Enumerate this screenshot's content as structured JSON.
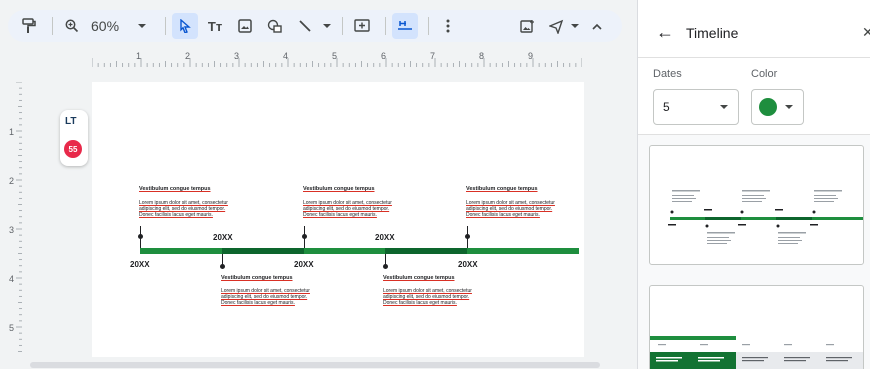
{
  "toolbar": {
    "zoom": "60%"
  },
  "ruler": {
    "h_numbers": [
      "1",
      "2",
      "3",
      "4",
      "5",
      "6",
      "7",
      "8",
      "9"
    ],
    "v_numbers": [
      "1",
      "2",
      "3",
      "4",
      "5"
    ]
  },
  "languagetool": {
    "badge_count": "55",
    "logo_text": "LT"
  },
  "timeline": {
    "accent_color": "#1e8e3e",
    "dark_segment_color": "#0d652d",
    "dates": [
      "20XX",
      "20XX",
      "20XX",
      "20XX",
      "20XX"
    ],
    "events": [
      {
        "title": "Vestibulum congue tempus",
        "body": "Lorem ipsum dolor sit amet, consectetur adipiscing elit, sed do eiusmod tempor. Donec facilisis lacus eget mauris."
      },
      {
        "title": "Vestibulum congue tempus",
        "body": "Lorem ipsum dolor sit amet, consectetur adipiscing elit, sed do eiusmod tempor. Donec facilisis lacus eget mauris."
      },
      {
        "title": "Vestibulum congue tempus",
        "body": "Lorem ipsum dolor sit amet, consectetur adipiscing elit, sed do eiusmod tempor. Donec facilisis lacus eget mauris."
      },
      {
        "title": "Vestibulum congue tempus",
        "body": "Lorem ipsum dolor sit amet, consectetur adipiscing elit, sed do eiusmod tempor. Donec facilisis lacus eget mauris."
      },
      {
        "title": "Vestibulum congue tempus",
        "body": "Lorem ipsum dolor sit amet, consectetur adipiscing elit, sed do eiusmod tempor. Donec facilisis lacus eget mauris."
      }
    ]
  },
  "panel": {
    "title": "Timeline",
    "dates_label": "Dates",
    "dates_value": "5",
    "color_label": "Color",
    "color_value": "#1e8e3e"
  }
}
